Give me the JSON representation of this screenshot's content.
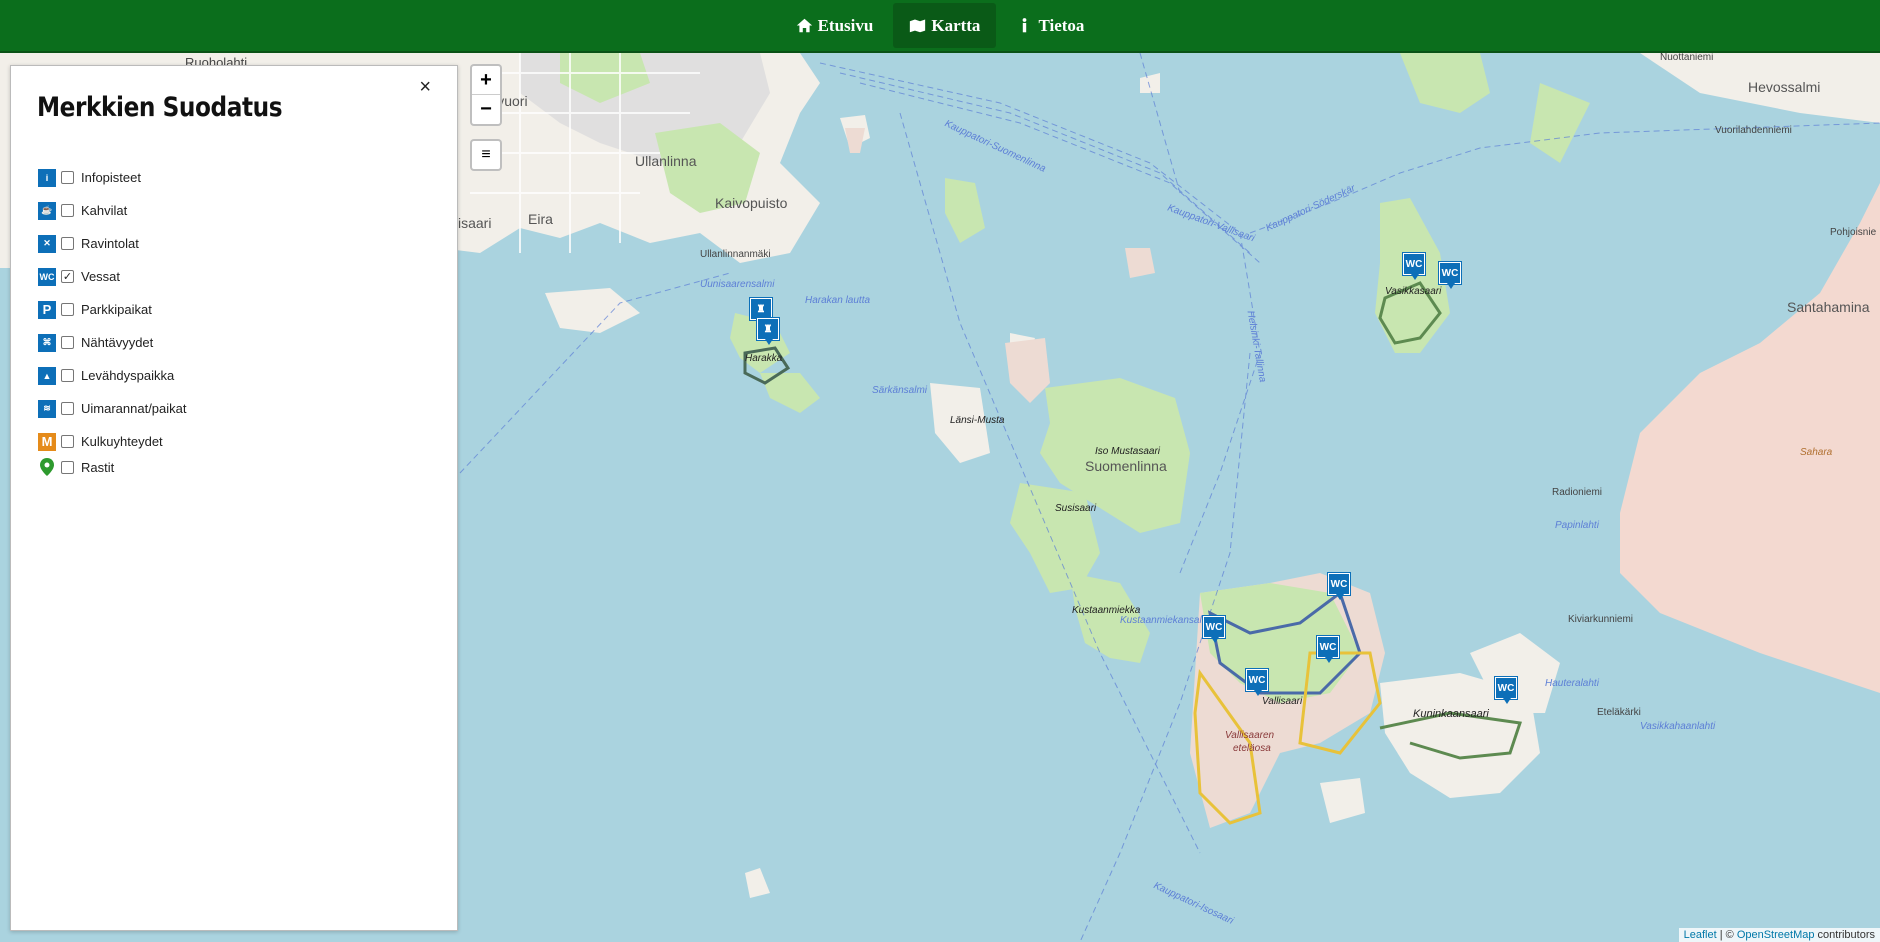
{
  "nav": {
    "items": [
      {
        "label": "Etusivu",
        "icon": "home-icon"
      },
      {
        "label": "Kartta",
        "icon": "map-icon",
        "active": true
      },
      {
        "label": "Tietoa",
        "icon": "info-icon"
      }
    ]
  },
  "panel": {
    "title": "Merkkien Suodatus",
    "close_label": "×",
    "filters": [
      {
        "label": "Infopisteet",
        "icon": "info-point-icon",
        "glyph": "i",
        "checked": false
      },
      {
        "label": "Kahvilat",
        "icon": "cafe-icon",
        "glyph": "☕",
        "checked": false
      },
      {
        "label": "Ravintolat",
        "icon": "restaurant-icon",
        "glyph": "✕",
        "checked": false
      },
      {
        "label": "Vessat",
        "icon": "wc-icon",
        "glyph": "WC",
        "checked": true
      },
      {
        "label": "Parkkipaikat",
        "icon": "parking-icon",
        "glyph": "P",
        "checked": false
      },
      {
        "label": "Nähtävyydet",
        "icon": "sights-icon",
        "glyph": "⌘",
        "checked": false
      },
      {
        "label": "Levähdyspaikka",
        "icon": "rest-area-icon",
        "glyph": "▲",
        "checked": false
      },
      {
        "label": "Uimarannat/paikat",
        "icon": "swimming-icon",
        "glyph": "≋",
        "checked": false
      },
      {
        "label": "Kulkuyhteydet",
        "icon": "transport-icon",
        "glyph": "M",
        "checked": false
      },
      {
        "label": "Rastit",
        "icon": "checkpoint-pin-icon",
        "glyph": "●",
        "checked": false
      }
    ]
  },
  "map": {
    "zoom_in": "+",
    "zoom_out": "−",
    "layers": "≡",
    "labels": {
      "ruoholahti": "Ruoholahti",
      "kamppi": "mnavuori",
      "ullanlinna": "Ullanlinna",
      "kaivopuisto": "Kaivopuisto",
      "eira": "Eira",
      "sisaari": "isaari",
      "ullanlinnanmaki": "Ullanlinnanmäki",
      "harakka": "Harakka",
      "lansi_musta": "Länsi-Musta",
      "iso_mustasaari": "Iso Mustasaari",
      "suomenlinna": "Suomenlinna",
      "susisaari": "Susisaari",
      "kustaanmiekka": "Kustaanmiekka",
      "vasikkasaari": "Vasikkasaari",
      "vallisaari": "Vallisaari",
      "vallisaaren_etelaosa_1": "Vallisaaren",
      "vallisaaren_etelaosa_2": "eteläosa",
      "kuninkaansaari": "Kuninkaansaari",
      "santahamina": "Santahamina",
      "hevossalmi": "Hevossalmi",
      "nuottaniemi": "Nuottaniemi",
      "vuorilahdenniemi": "Vuorilahdenniemi",
      "radioniemi": "Radioniemi",
      "kiviarkunniemi": "Kiviarkunniemi",
      "etelakarki": "Eteläkärki",
      "pohjoisnie": "Pohjoisnie",
      "sahara": "Sahara",
      "harakan_lautta": "Harakan lautta",
      "kauppatori_suomenlinna": "Kauppatori-Suomenlinna",
      "kauppatori_isosaari": "Kauppatori-Isosaari",
      "kauppatori_vallisaari": "Kauppatori-Vallisaari",
      "kauppatori_soderskar": "Kauppatori-Söderskär",
      "helsinki_tallinna": "Helsinki-Tallinna",
      "sarkansalmi": "Särkänsalmi",
      "uunisaarensalmi": "Uunisaarensalmi",
      "kustaanmiekansalmi": "Kustaanmiekansalmi",
      "hauteralahti": "Hauteralahti",
      "papinlahti": "Papinlahti",
      "vasikkahaanlahti": "Vasikkahaanlahti"
    },
    "wc_marker": "WC",
    "tower_marker": "♜"
  },
  "attribution": {
    "leaflet": "Leaflet",
    "separator": " | © ",
    "osm": "OpenStreetMap",
    "suffix": " contributors"
  },
  "colors": {
    "nav_bg": "#0b6e1c",
    "water": "#aad3df",
    "land": "#f2efe9",
    "park": "#c8e6b0",
    "marker": "#0d6fb8",
    "route_green": "#5d8a50",
    "route_yellow": "#e8c23a",
    "route_blue": "#4a6aa8"
  }
}
